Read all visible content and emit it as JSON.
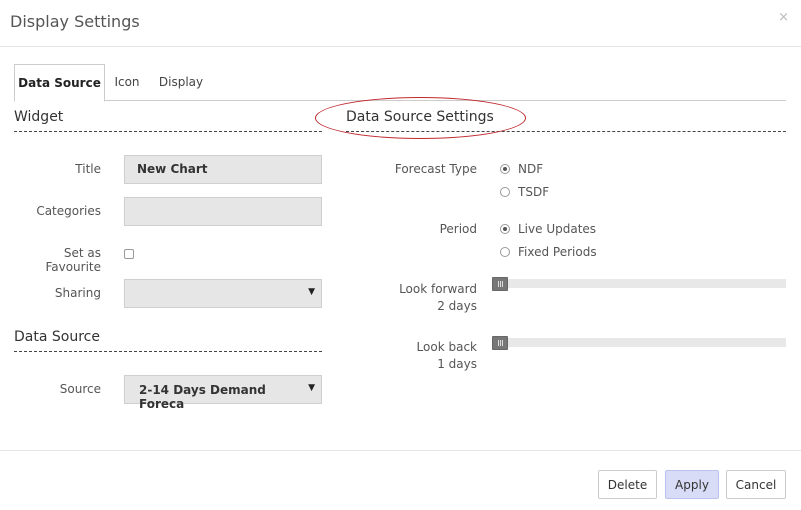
{
  "dialog": {
    "title": "Display Settings",
    "close_symbol": "×"
  },
  "tabs": [
    {
      "label": "Data Source",
      "active": true
    },
    {
      "label": "Icon",
      "active": false
    },
    {
      "label": "Display",
      "active": false
    }
  ],
  "widget": {
    "heading": "Widget",
    "title_label": "Title",
    "title_value": "New Chart",
    "categories_label": "Categories",
    "categories_value": "",
    "favourite_label": "Set as Favourite",
    "sharing_label": "Sharing",
    "sharing_value": ""
  },
  "data_source": {
    "heading": "Data Source",
    "source_label": "Source",
    "source_value": "2-14 Days Demand Foreca"
  },
  "settings": {
    "heading": "Data Source Settings",
    "forecast_type_label": "Forecast Type",
    "forecast_options": [
      "NDF",
      "TSDF"
    ],
    "forecast_selected": "NDF",
    "period_label": "Period",
    "period_options": [
      "Live Updates",
      "Fixed Periods"
    ],
    "period_selected": "Live Updates",
    "look_forward_label": "Look forward",
    "look_forward_value": "2 days",
    "look_forward_level": 0,
    "look_back_label": "Look back",
    "look_back_value": "1 days",
    "look_back_level": 0
  },
  "footer": {
    "delete_label": "Delete",
    "apply_label": "Apply",
    "cancel_label": "Cancel"
  },
  "colors": {
    "accent": "#d8dcf6",
    "annotation": "#c0292f"
  }
}
